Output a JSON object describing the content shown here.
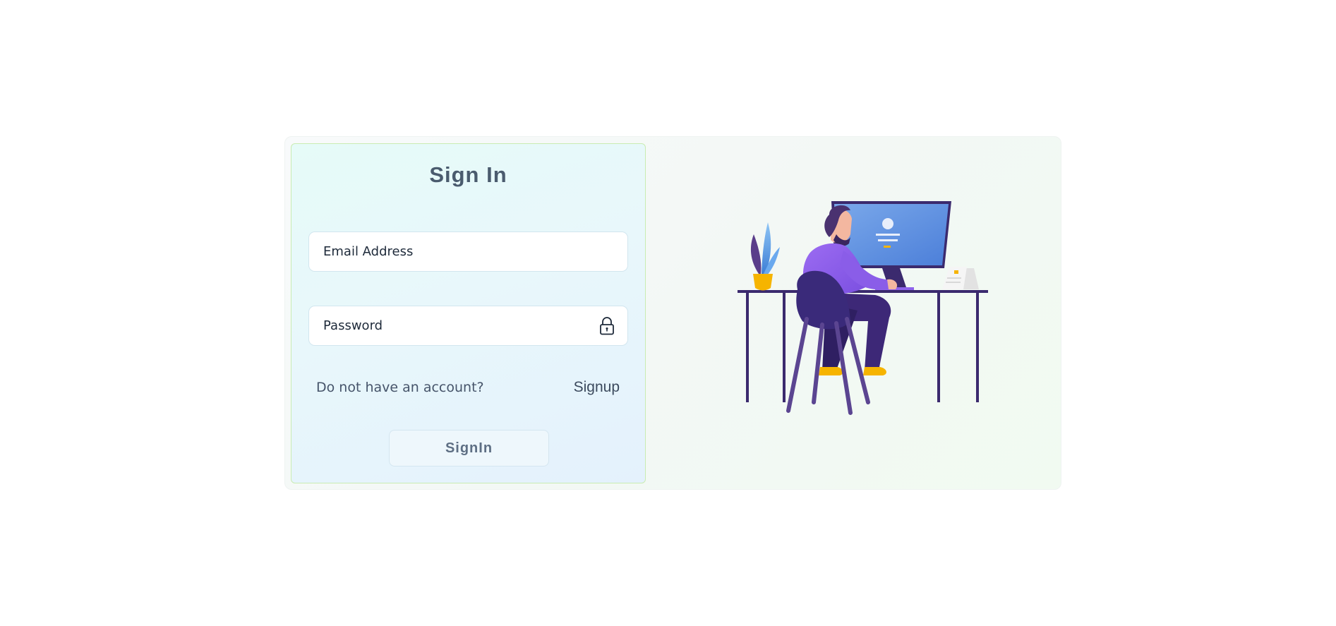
{
  "signin_form": {
    "title": "Sign In",
    "email_placeholder": "Email Address",
    "password_placeholder": "Password",
    "no_account_text": "Do not have an account?",
    "signup_link": "Signup",
    "signin_button": "SignIn"
  },
  "icons": {
    "password_field": "lock-icon",
    "illustration": "person-at-desk-illustration"
  },
  "colors": {
    "title": "#4a5b6e",
    "panel_border": "#c9ecb2",
    "illustration_purple": "#3b2a6e",
    "illustration_blue": "#5b8fe0",
    "illustration_yellow": "#f6b400"
  }
}
